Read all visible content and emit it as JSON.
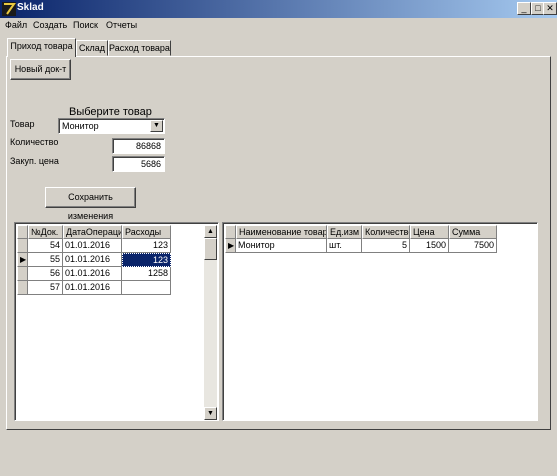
{
  "window": {
    "title": "Sklad",
    "controls": [
      "_",
      "□",
      "✕"
    ]
  },
  "menu": [
    "Файл",
    "Создать",
    "Поиск",
    "Отчеты"
  ],
  "tabs": [
    "Приход товара",
    "Склад",
    "Расход товара"
  ],
  "buttons": {
    "new_doc": "Новый док-т",
    "save_changes": "Сохранить изменения"
  },
  "form": {
    "choose_caption": "Выберите товар",
    "product_label": "Товар",
    "product_value": "Монитор",
    "quantity_label": "Количество",
    "quantity_value": "86868",
    "price_label": "Закуп. цена",
    "price_value": "5686"
  },
  "left_grid": {
    "columns": [
      "№Док.",
      "ДатаОперации",
      "Расходы"
    ],
    "rows": [
      [
        "54",
        "01.01.2016",
        "123"
      ],
      [
        "55",
        "01.01.2016",
        "123"
      ],
      [
        "56",
        "01.01.2016",
        "1258"
      ],
      [
        "57",
        "01.01.2016",
        ""
      ]
    ],
    "current_row": 1
  },
  "right_grid": {
    "columns": [
      "Наименование товара",
      "Ед.изм",
      "Количество",
      "Цена",
      "Сумма"
    ],
    "rows": [
      [
        "Монитор",
        "шт.",
        "5",
        "1500",
        "7500"
      ]
    ],
    "current_row": 0
  },
  "icons": {
    "row_pointer": "▶",
    "scroll_up": "▲",
    "scroll_down": "▼",
    "combo_arrow": "▼"
  }
}
